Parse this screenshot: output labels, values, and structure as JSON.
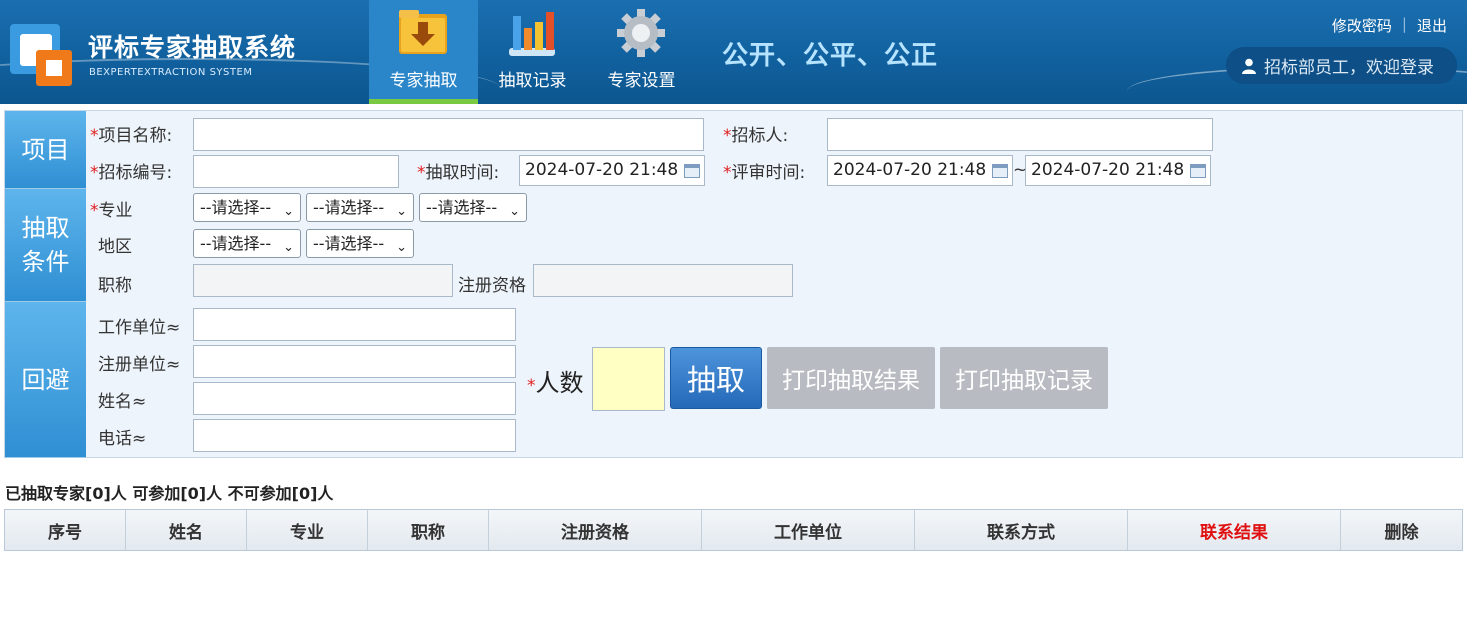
{
  "header": {
    "app_title": "评标专家抽取系统",
    "app_subtitle": "BEXPERTEXTRACTION SYSTEM",
    "nav": [
      {
        "label": "专家抽取",
        "icon": "folder-download-icon",
        "active": true
      },
      {
        "label": "抽取记录",
        "icon": "bar-chart-icon",
        "active": false
      },
      {
        "label": "专家设置",
        "icon": "gear-icon",
        "active": false
      }
    ],
    "slogan": "公开、公平、公正",
    "change_password": "修改密码",
    "logout": "退出",
    "user_greeting": "招标部员工，欢迎登录"
  },
  "form": {
    "section_project": "项目",
    "section_conditions": "抽取条件",
    "section_avoid": "回避",
    "required_mark": "*",
    "project_name_label": "项目名称:",
    "project_name_value": "",
    "tenderer_label": "招标人:",
    "tenderer_value": "",
    "tender_no_label": "招标编号:",
    "tender_no_value": "",
    "draw_time_label": "抽取时间:",
    "draw_time_value": "2024-07-20 21:48",
    "review_time_label": "评审时间:",
    "review_time_start": "2024-07-20 21:48",
    "review_time_sep": "~",
    "review_time_end": "2024-07-20 21:48",
    "major_label": "专业",
    "region_label": "地区",
    "select_placeholder": "--请选择--",
    "title_label": "职称",
    "title_value": "",
    "reg_qual_label": "注册资格",
    "reg_qual_value": "",
    "work_unit_label": "工作单位≈",
    "reg_unit_label": "注册单位≈",
    "name_label": "姓名≈",
    "phone_label": "电话≈",
    "people_label": "人数",
    "people_value": "",
    "draw_button": "抽取",
    "print_result_button": "打印抽取结果",
    "print_record_button": "打印抽取记录"
  },
  "summary": "已抽取专家[0]人 可参加[0]人 不可参加[0]人",
  "table": {
    "columns": [
      "序号",
      "姓名",
      "专业",
      "职称",
      "注册资格",
      "工作单位",
      "联系方式",
      "联系结果",
      "删除"
    ],
    "highlight_color": "#e01010",
    "rows": []
  },
  "colors": {
    "header_blue": "#11619f",
    "accent_green": "#7ac943",
    "panel_bg": "#eef4fb",
    "side_blue": "#2f8fd3",
    "people_box": "#ffffc4"
  }
}
